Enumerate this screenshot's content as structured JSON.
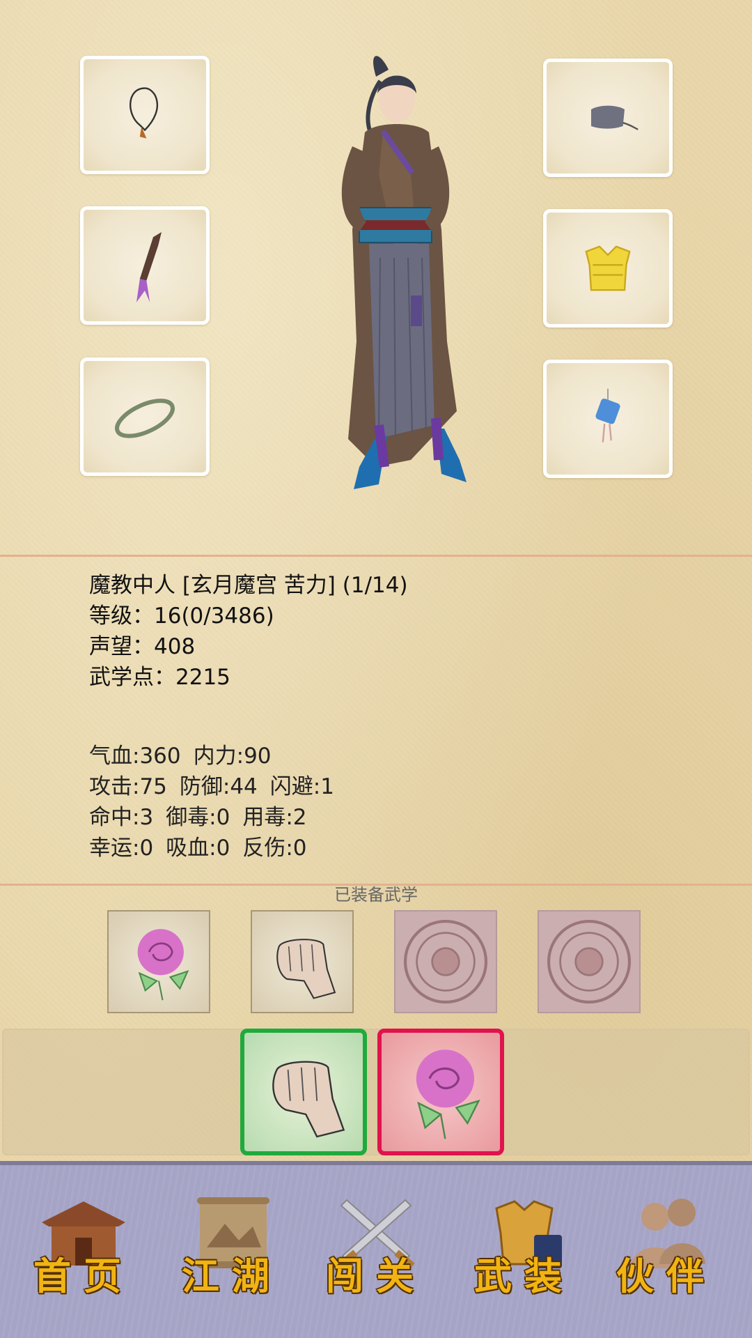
{
  "equipment": {
    "left_slots": [
      {
        "icon": "necklace-icon"
      },
      {
        "icon": "dagger-icon"
      },
      {
        "icon": "bracelet-icon"
      }
    ],
    "right_slots": [
      {
        "icon": "hat-icon"
      },
      {
        "icon": "armor-vest-icon"
      },
      {
        "icon": "pendant-icon"
      }
    ]
  },
  "character": {
    "title_line": "魔教中人 [玄月魔宫 苦力] (1/14)",
    "level_line": "等级：16(0/3486)",
    "reputation_line": "声望：408",
    "martial_points_line": "武学点：2215"
  },
  "stats": {
    "row1": [
      "气血:360",
      "内力:90"
    ],
    "row2": [
      "攻击:75",
      "防御:44",
      "闪避:1"
    ],
    "row3": [
      "命中:3",
      "御毒:0",
      "用毒:2"
    ],
    "row4": [
      "幸运:0",
      "吸血:0",
      "反伤:0"
    ]
  },
  "equipped_skills": {
    "label": "已装备武学",
    "slots": [
      {
        "icon": "rose-skill-icon",
        "state": "equipped"
      },
      {
        "icon": "fist-skill-icon",
        "state": "equipped"
      },
      {
        "icon": "locked-medallion-icon",
        "state": "locked"
      },
      {
        "icon": "locked-medallion-icon",
        "state": "locked"
      }
    ]
  },
  "active_skills": [
    {
      "icon": "fist-skill-icon",
      "color": "#1faa3c"
    },
    {
      "icon": "rose-skill-icon",
      "color": "#e0134e"
    }
  ],
  "nav": {
    "items": [
      {
        "label": "首页",
        "icon": "house-icon"
      },
      {
        "label": "江湖",
        "icon": "scroll-icon"
      },
      {
        "label": "闯关",
        "icon": "crossed-swords-icon"
      },
      {
        "label": "武装",
        "icon": "armor-icon"
      },
      {
        "label": "伙伴",
        "icon": "companions-icon"
      }
    ]
  },
  "colors": {
    "background": "#e9d7ab",
    "divider": "#e3b18f",
    "nav_background": "#a6a4c6",
    "nav_label": "#f2b413"
  }
}
